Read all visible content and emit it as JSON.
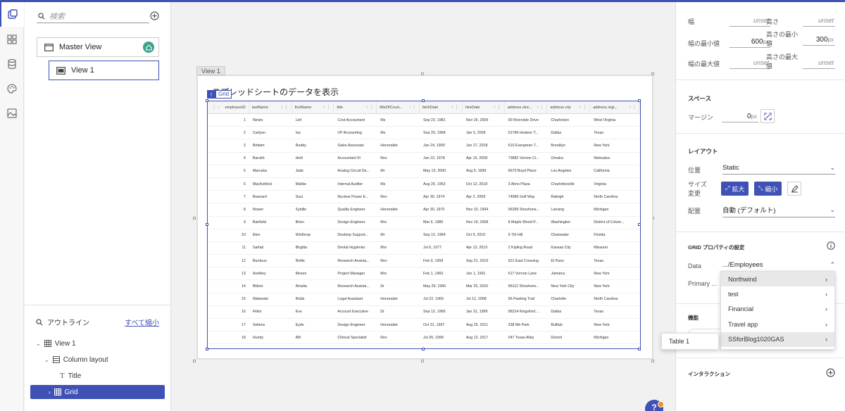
{
  "left_panel": {
    "search_placeholder": "検索",
    "master_view": "Master View",
    "view1": "View 1",
    "outline_title": "アウトライン",
    "collapse_all": "すべて縮小",
    "outline": [
      "View 1",
      "Column layout",
      "Title",
      "Grid"
    ]
  },
  "canvas": {
    "view_tag": "View 1",
    "page_title": "スプレッドシートのデータを表示",
    "grid_tag": "Grid",
    "columns": [
      "employeeID",
      "lastName",
      "firstName",
      "title",
      "titleOfCourt...",
      "birthDate",
      "hireDate",
      "address stre...",
      "address city",
      "address regi..."
    ],
    "rows": [
      [
        "1",
        "Newis",
        "Lief",
        "Cost Accountant",
        "Ms",
        "Sep 23, 1981",
        "Nov 26, 2009",
        "00 Riverside Drive",
        "Charleston",
        "West Virginia"
      ],
      [
        "2",
        "Carlyon",
        "Isa",
        "VP Accounting",
        "Ms",
        "Sep 20, 1968",
        "Jan 6, 2009",
        "01784 Hudson T...",
        "Dallas",
        "Texas"
      ],
      [
        "3",
        "Bettam",
        "Ruddy",
        "Sales Associate",
        "Honorable",
        "Jan 24, 1999",
        "Jun 27, 2018",
        "610 Evergreen T...",
        "Brooklyn",
        "New York"
      ],
      [
        "4",
        "Barukh",
        "Helli",
        "Accountant III",
        "Rev",
        "Jan 22, 1978",
        "Apr 15, 2008",
        "73882 Vernon Cr...",
        "Omaha",
        "Nebraska"
      ],
      [
        "5",
        "Maruska",
        "Jade",
        "Analog Circuit De...",
        "Mr",
        "May 13, 2000",
        "Aug 5, 1999",
        "6670 Boyd Place",
        "Los Angeles",
        "California"
      ],
      [
        "6",
        "MacKettrick",
        "Walliw",
        "Internal Auditor",
        "Ms",
        "Aug 26, 1953",
        "Oct 12, 2018",
        "3 Almo Plaza",
        "Charlottesville",
        "Virginia"
      ],
      [
        "7",
        "Beanard",
        "Susi",
        "Nuclear Power E...",
        "Rev",
        "Apr 30, 1974",
        "Apr 2, 2009",
        "74989 Golf Way",
        "Raleigh",
        "North Carolina"
      ],
      [
        "8",
        "Nower",
        "Sybille",
        "Quality Engineer",
        "Honorable",
        "Apr 30, 1970",
        "Nov 10, 1994",
        "06399 Shoshone...",
        "Lansing",
        "Michigan"
      ],
      [
        "9",
        "Banfield",
        "Brien",
        "Design Engineer",
        "Mrs",
        "Mar 6, 1985",
        "Nov 19, 2008",
        "8 Maple Wood P...",
        "Washington",
        "District of Colum..."
      ],
      [
        "10",
        "Elen",
        "Winthrop",
        "Desktop Support...",
        "Mr",
        "Sep 12, 1964",
        "Oct 9, 2015",
        "9 7th Hill",
        "Clearwater",
        "Florida"
      ],
      [
        "11",
        "Sarfati",
        "Birgitta",
        "Dental Hygienist",
        "Mrs",
        "Jul 6, 1977",
        "Apr 13, 2019",
        "2 Kipling Road",
        "Kansas City",
        "Missouri"
      ],
      [
        "12",
        "Burdoun",
        "Rollie",
        "Research Assista...",
        "Rev",
        "Feb 9, 1958",
        "Sep 21, 2019",
        "621 East Crossing",
        "El Paso",
        "Texas"
      ],
      [
        "13",
        "Axelbey",
        "Moses",
        "Project Manager",
        "Mrs",
        "Feb 1, 1960",
        "Jun 1, 1991",
        "617 Vernon Lane",
        "Jamaica",
        "New York"
      ],
      [
        "14",
        "Blitzer",
        "Amalia",
        "Research Assista...",
        "Dr",
        "May 29, 1960",
        "Mar 25, 2020",
        "96112 Shoshone...",
        "New York City",
        "New York"
      ],
      [
        "15",
        "Walewski",
        "Robb",
        "Legal Assistant",
        "Honorable",
        "Jul 22, 1969",
        "Jul 12, 2008",
        "56 Pawling Trail",
        "Charlotte",
        "North Carolina"
      ],
      [
        "16",
        "Fitkin",
        "Eve",
        "Account Executive",
        "Dr",
        "Sep 12, 1966",
        "Jan 31, 1999",
        "96314 Kingsford ...",
        "Dallas",
        "Texas"
      ],
      [
        "17",
        "Sellens",
        "Eyde",
        "Design Engineer",
        "Honorable",
        "Oct 31, 1997",
        "Aug 25, 2011",
        "338 8th Park",
        "Buffalo",
        "New York"
      ],
      [
        "18",
        "Hundy",
        "Alfi",
        "Clinical Specialist",
        "Rev",
        "Jul 26, 1999",
        "Aug 12, 2017",
        "047 Texas Alley",
        "Detroit",
        "Michigan"
      ]
    ]
  },
  "right_panel": {
    "width": "幅",
    "width_val": "unset",
    "height": "高さ",
    "height_val": "unset",
    "min_width": "幅の最小値",
    "min_width_val": "600",
    "px": "px",
    "min_height": "高さの最小値",
    "min_height_val": "300",
    "max_width": "幅の最大値",
    "max_width_val": "unset",
    "max_height": "高さの最大値",
    "max_height_val": "unset",
    "space": "スペース",
    "margin": "マージン",
    "margin_val": "0",
    "layout": "レイアウト",
    "position": "位置",
    "position_val": "Static",
    "resize": "サイズ変更",
    "expand": "拡大",
    "shrink": "縮小",
    "placement": "配置",
    "placement_val": "自動 (デフォルト)",
    "grid_props": "GRID プロパティの設定",
    "data": "Data",
    "data_val": ".../Employees",
    "primary": "Primary ...",
    "features": "機能",
    "interaction": "インタラクション"
  },
  "dropdown": [
    "Northwind",
    "test",
    "Financial",
    "Travel app",
    "SSforBlog1020GAS"
  ],
  "submenu": "Table 1",
  "help": "?"
}
